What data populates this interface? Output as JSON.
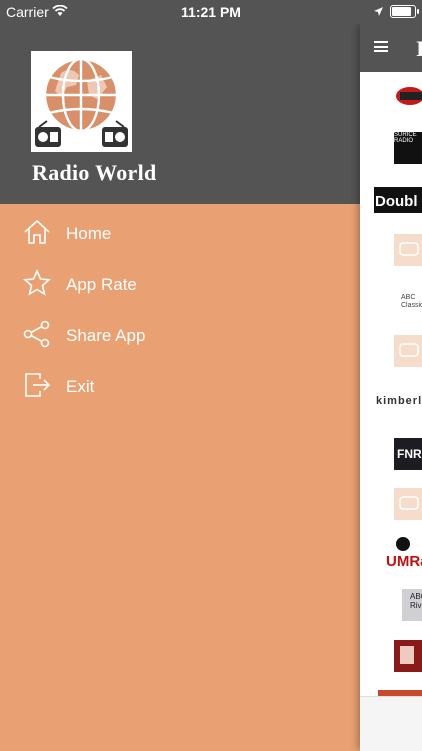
{
  "status_bar": {
    "carrier": "Carrier",
    "time": "11:21 PM"
  },
  "drawer": {
    "app_title": "Radio World",
    "menu": [
      {
        "label": "Home",
        "icon": "home-icon"
      },
      {
        "label": "App Rate",
        "icon": "star-icon"
      },
      {
        "label": "Share App",
        "icon": "share-icon"
      },
      {
        "label": "Exit",
        "icon": "exit-icon"
      }
    ]
  },
  "main": {
    "nav_title_fragment": "I",
    "stations": [
      {
        "text": ""
      },
      {
        "text": "SURICE RADIO"
      },
      {
        "text": "Doubl"
      },
      {
        "text": ""
      },
      {
        "text": "ABC Classic"
      },
      {
        "text": ""
      },
      {
        "text": "kimberley"
      },
      {
        "text": "FNR"
      },
      {
        "text": ""
      },
      {
        "text": "UMRad"
      },
      {
        "text": "ABC Riverina"
      },
      {
        "text": ""
      }
    ]
  },
  "colors": {
    "drawer_bg": "#e9a072",
    "header_bg": "#545454",
    "text": "#ffffff"
  }
}
